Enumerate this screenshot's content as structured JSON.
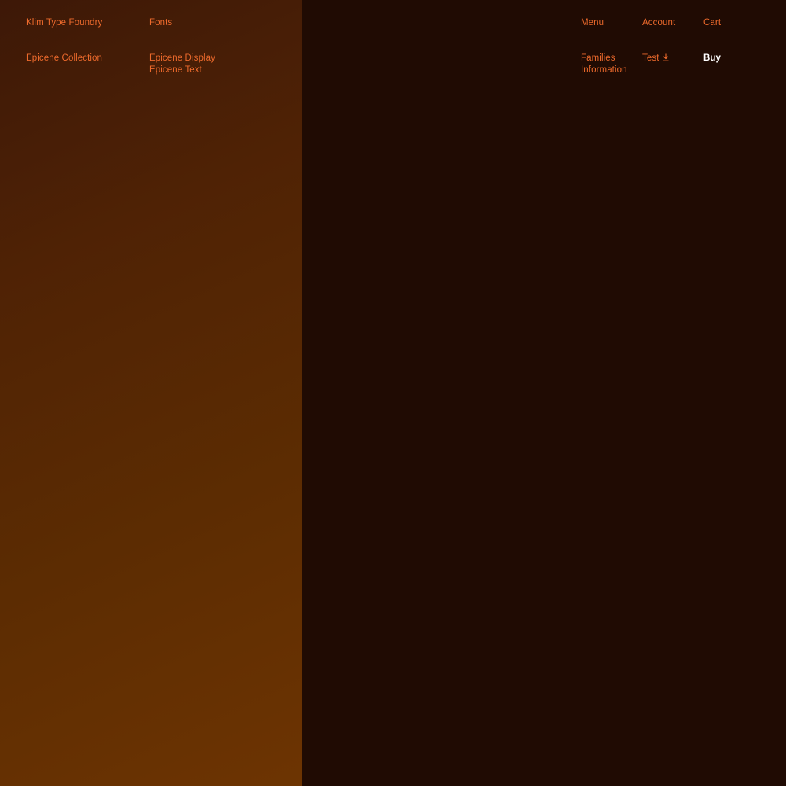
{
  "header": {
    "brand": "Klim Type Foundry",
    "fonts_label": "Fonts",
    "menu_label": "Menu",
    "account_label": "Account",
    "cart_label": "Cart"
  },
  "subnav": {
    "collection_label": "Epicene Collection",
    "fonts": [
      {
        "label": "Epicene Display"
      },
      {
        "label": "Epicene Text"
      }
    ],
    "families_label": "Families",
    "information_label": "Information",
    "test_label": "Test",
    "buy_label": "Buy"
  },
  "colors": {
    "link": "#ed6a2c",
    "buy": "#ffffff",
    "dark_background": "#200b03",
    "panel_gradient_start": "#3d1807",
    "panel_gradient_end": "#6d3402"
  },
  "icons": {
    "test_icon": "download-icon"
  }
}
